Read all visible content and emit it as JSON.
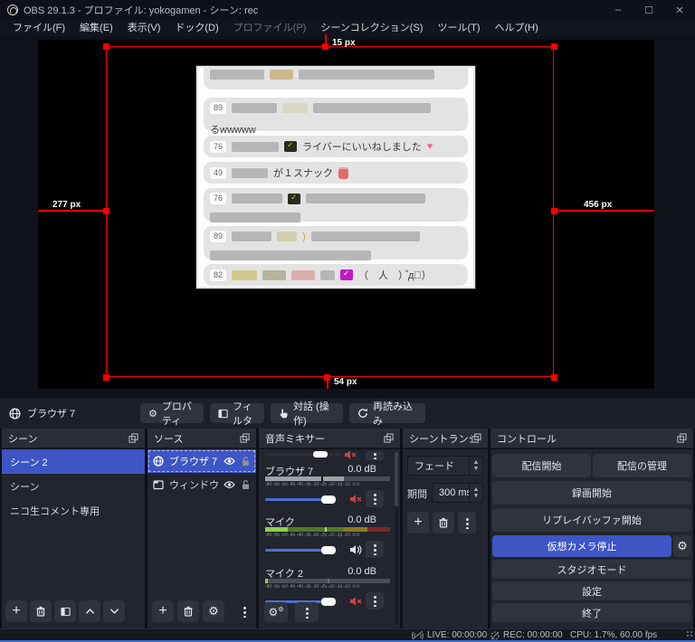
{
  "window": {
    "title": "OBS 29.1.3 - プロファイル: yokogamen - シーン: rec",
    "controls": {
      "minimize": "–",
      "maximize": "☐",
      "close": "✕"
    }
  },
  "menu": {
    "items": [
      "ファイル(F)",
      "編集(E)",
      "表示(V)",
      "ドック(D)",
      "プロファイル(P)",
      "シーンコレクション(S)",
      "ツール(T)",
      "ヘルプ(H)"
    ]
  },
  "preview": {
    "measurements": {
      "top": "15 px",
      "left": "277 px",
      "right": "456 px",
      "bottom": "54 px"
    },
    "chat_rows": [
      {
        "badge": ""
      },
      {
        "badge": "89",
        "text": "るwwwww"
      },
      {
        "badge": "76",
        "text": "ライバーにいいねしました",
        "heart": "♥"
      },
      {
        "badge": "49",
        "text": "が１スナック"
      },
      {
        "badge": "76",
        "text": ""
      },
      {
        "badge": "89",
        "text": ""
      },
      {
        "badge": "82",
        "text": "（　人　）゚д゚）"
      }
    ]
  },
  "source_toolbar": {
    "source_label": "ブラウザ 7",
    "properties": "プロパティ",
    "filters": "フィルタ",
    "interact": "対話 (操作)",
    "refresh": "再読み込み"
  },
  "scenes": {
    "header": "シーン",
    "items": [
      "シーン 2",
      "シーン",
      "ニコ生コメント専用"
    ]
  },
  "sources": {
    "header": "ソース",
    "items": [
      "ブラウザ 7",
      "ウィンドウキ"
    ]
  },
  "mixer": {
    "header": "音声ミキサー",
    "scale": "-60 -55 -50 -45 -40 -35 -30 -25 -20 -15 -10 -5 0",
    "channels": [
      {
        "name": "ブラウザ 7",
        "db": "0.0 dB"
      },
      {
        "name": "マイク",
        "db": "0.0 dB"
      },
      {
        "name": "マイク 2",
        "db": "0.0 dB"
      }
    ]
  },
  "transitions": {
    "header": "シーントランジ...",
    "selected": "フェード",
    "duration_label": "期間",
    "duration_value": "300 ms"
  },
  "controls": {
    "header": "コントロール",
    "start_streaming": "配信開始",
    "manage_broadcast": "配信の管理",
    "start_recording": "録画開始",
    "start_replay": "リプレイバッファ開始",
    "stop_vcam": "仮想カメラ停止",
    "studio_mode": "スタジオモード",
    "settings": "設定",
    "exit": "終了"
  },
  "status": {
    "live": "LIVE: 00:00:00",
    "rec": "REC: 00:00:00",
    "stats": "CPU: 1.7%, 60.00 fps"
  },
  "colors": {
    "accent_blue": "#3e55c4",
    "selection_red": "#ff0000",
    "slider_blue": "#4a6fd4",
    "meter_green_bright": "#8ed04a",
    "meter_green_dim": "#4d7a2e",
    "meter_olive": "#8a7a24",
    "meter_red": "#7d2726",
    "mute_red": "#c94040"
  }
}
